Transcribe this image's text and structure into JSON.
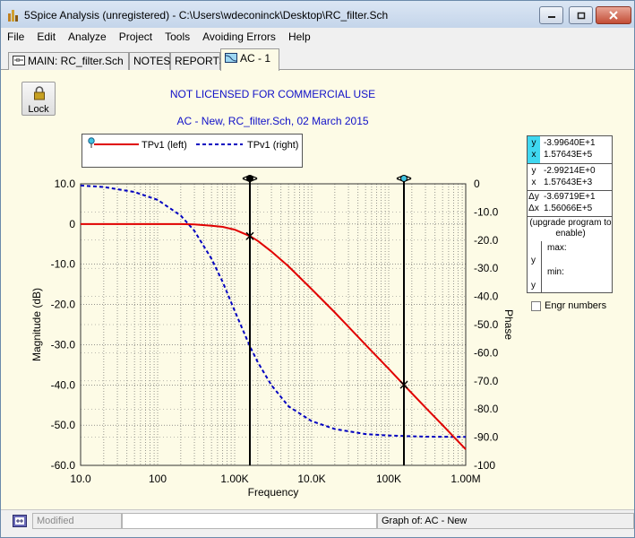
{
  "window": {
    "title": "5Spice Analysis (unregistered) - C:\\Users\\wdeconinck\\Desktop\\RC_filter.Sch"
  },
  "menu": [
    "File",
    "Edit",
    "Analyze",
    "Project",
    "Tools",
    "Avoiding Errors",
    "Help"
  ],
  "tabs": {
    "main": "MAIN:  RC_filter.Sch",
    "notes": "NOTES",
    "reports": "REPORTS",
    "ac": "AC - 1"
  },
  "lock_label": "Lock",
  "banner": {
    "license": "NOT LICENSED FOR COMMERCIAL USE",
    "analysis": "AC - New,    RC_filter.Sch,    02 March 2015"
  },
  "legend": {
    "series1": "TPv1 (left)",
    "series2": "TPv1 (right)"
  },
  "readout": {
    "row1_label": "y",
    "row1_value": "-3.99640E+1",
    "row2_label": "x",
    "row2_value": "1.57643E+5",
    "row3_label": "y",
    "row3_value": "-2.99214E+0",
    "row4_label": "x",
    "row4_value": "1.57643E+3",
    "row5_label": "Δy",
    "row5_value": "-3.69719E+1",
    "row6_label": "Δx",
    "row6_value": "1.56066E+5",
    "upgrade": "(upgrade program to enable)",
    "max_y": "y",
    "max_label": "max:",
    "min_y": "y",
    "min_label": "min:"
  },
  "engr_label": "Engr numbers",
  "status": {
    "modified": "Modified",
    "graph_of": "Graph of:  AC - New"
  },
  "chart_data": {
    "type": "line",
    "xlabel": "Frequency",
    "ylabel_left": "Magnitude  (dB)",
    "ylabel_right": "Phase",
    "x_scale": "log",
    "xlim": [
      10,
      1000000
    ],
    "ylim_left": [
      -60,
      10
    ],
    "ylim_right": [
      -100,
      0
    ],
    "grid": true,
    "x_ticks": [
      "10.0",
      "100",
      "1.00K",
      "10.0K",
      "100K",
      "1.00M"
    ],
    "y_left_ticks": [
      "10.0",
      "0",
      "-10.0",
      "-20.0",
      "-30.0",
      "-40.0",
      "-50.0",
      "-60.0"
    ],
    "y_right_ticks": [
      "0",
      "-10.0",
      "-20.0",
      "-30.0",
      "-40.0",
      "-50.0",
      "-60.0",
      "-70.0",
      "-80.0",
      "-90.0",
      "-100"
    ],
    "series": [
      {
        "name": "TPv1 (left)",
        "axis": "left",
        "color": "#e00000",
        "style": "solid",
        "x": [
          10,
          20,
          50,
          100,
          200,
          300,
          500,
          700,
          1000,
          1576,
          2000,
          3000,
          5000,
          10000,
          20000,
          50000,
          100000,
          157643,
          300000,
          500000,
          1000000
        ],
        "y": [
          0,
          0,
          0,
          0,
          0,
          -0.1,
          -0.4,
          -0.7,
          -1.4,
          -3.0,
          -4.2,
          -6.8,
          -10.5,
          -16.2,
          -22,
          -30,
          -36,
          -40,
          -45.6,
          -50,
          -56
        ]
      },
      {
        "name": "TPv1 (right)",
        "axis": "right",
        "color": "#0000c0",
        "style": "dashed",
        "x": [
          10,
          20,
          50,
          100,
          200,
          300,
          500,
          700,
          1000,
          1576,
          2000,
          3000,
          5000,
          10000,
          20000,
          50000,
          100000,
          300000,
          1000000
        ],
        "y": [
          -0.6,
          -1.1,
          -2.9,
          -5.7,
          -11.3,
          -16.7,
          -26.6,
          -34.9,
          -45.1,
          -57.7,
          -63.4,
          -71.5,
          -79.0,
          -84.3,
          -87.1,
          -88.9,
          -89.4,
          -89.8,
          -89.9
        ]
      }
    ],
    "cursors": [
      {
        "x": 1576.43,
        "y": -2.99214
      },
      {
        "x": 157643,
        "y": -39.964
      }
    ]
  }
}
